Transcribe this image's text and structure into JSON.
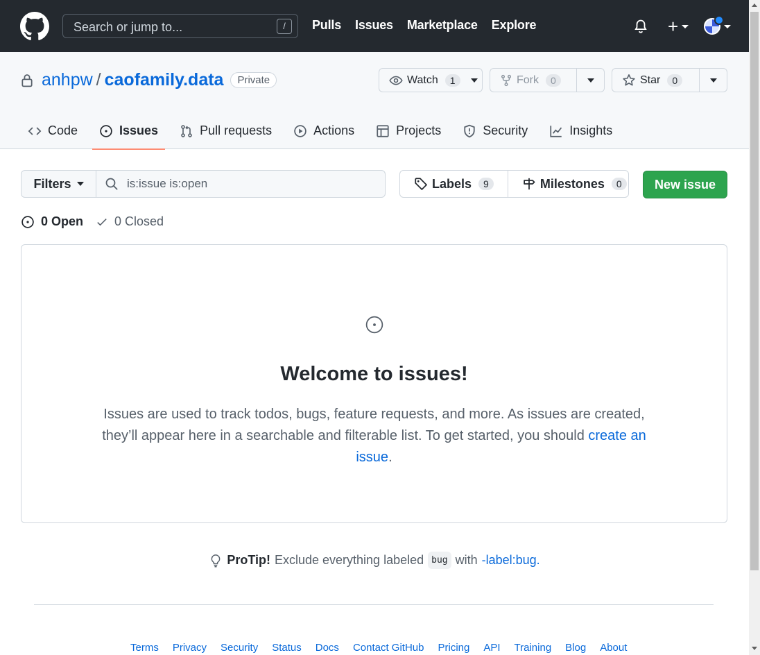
{
  "global_nav": {
    "search_placeholder": "Search or jump to...",
    "search_shortcut": "/",
    "links": [
      "Pulls",
      "Issues",
      "Marketplace",
      "Explore"
    ],
    "new_menu_label": "+"
  },
  "repo": {
    "owner": "anhpw",
    "separator": "/",
    "name": "caofamily.data",
    "visibility": "Private",
    "watch": {
      "label": "Watch",
      "count": "1"
    },
    "fork": {
      "label": "Fork",
      "count": "0"
    },
    "star": {
      "label": "Star",
      "count": "0"
    }
  },
  "tabs": [
    {
      "label": "Code",
      "icon": "code-icon"
    },
    {
      "label": "Issues",
      "icon": "issue-opened-icon",
      "active": true
    },
    {
      "label": "Pull requests",
      "icon": "git-pull-request-icon"
    },
    {
      "label": "Actions",
      "icon": "play-icon"
    },
    {
      "label": "Projects",
      "icon": "table-icon"
    },
    {
      "label": "Security",
      "icon": "shield-icon"
    },
    {
      "label": "Insights",
      "icon": "graph-icon"
    }
  ],
  "toolbar": {
    "filters_label": "Filters",
    "query": "is:issue is:open",
    "labels": {
      "label": "Labels",
      "count": "9"
    },
    "milestones": {
      "label": "Milestones",
      "count": "0"
    },
    "new_issue_label": "New issue"
  },
  "states": {
    "open_label": "0 Open",
    "closed_label": "0 Closed"
  },
  "blankslate": {
    "title": "Welcome to issues!",
    "body": "Issues are used to track todos, bugs, feature requests, and more. As issues are created, they’ll appear here in a searchable and filterable list. To get started, you should ",
    "link": "create an issue",
    "tail": "."
  },
  "protip": {
    "strong": "ProTip!",
    "text": "Exclude everything labeled",
    "code": "bug",
    "with": "with",
    "link": "-label:bug."
  },
  "footer": [
    "Terms",
    "Privacy",
    "Security",
    "Status",
    "Docs",
    "Contact GitHub",
    "Pricing",
    "API",
    "Training",
    "Blog",
    "About"
  ],
  "colors": {
    "header_bg": "#24292f",
    "link": "#0969da",
    "primary_button": "#2da44e",
    "active_tab_underline": "#fd8c73"
  }
}
